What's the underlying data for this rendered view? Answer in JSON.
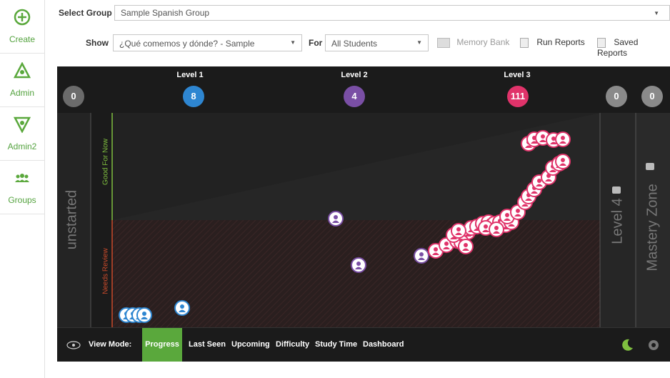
{
  "sidebar": {
    "items": [
      {
        "label": "Create",
        "icon": "plus-circle-icon"
      },
      {
        "label": "Admin",
        "icon": "admin-icon"
      },
      {
        "label": "Admin2",
        "icon": "admin2-icon"
      },
      {
        "label": "Groups",
        "icon": "groups-icon"
      }
    ],
    "accent": "#5aa83c"
  },
  "header": {
    "select_group_label": "Select Group",
    "select_group_value": "Sample Spanish Group",
    "show_label": "Show",
    "show_value": "¿Qué comemos y dónde? - Sample",
    "for_label": "For",
    "for_value": "All Students",
    "memory_bank": "Memory Bank",
    "run_reports": "Run Reports",
    "saved_reports": "Saved Reports"
  },
  "chart": {
    "levels": [
      {
        "title": "",
        "count": "0",
        "color": "#6b6b6b"
      },
      {
        "title": "Level 1",
        "count": "8",
        "color": "#2e86d1"
      },
      {
        "title": "Level 2",
        "count": "4",
        "color": "#7a4fa5"
      },
      {
        "title": "Level 3",
        "count": "111",
        "color": "#e0336a"
      },
      {
        "title": "",
        "count": "0",
        "color": "#8a8a8a"
      },
      {
        "title": "",
        "count": "0",
        "color": "#8a8a8a"
      }
    ],
    "zones": {
      "unstarted": "unstarted",
      "good_for_now": "Good For Now",
      "needs_review": "Needs Review",
      "level4": "Level 4",
      "mastery": "Mastery Zone"
    }
  },
  "view_mode": {
    "label": "View Mode:",
    "tabs": [
      "Progress",
      "Last Seen",
      "Upcoming",
      "Difficulty",
      "Study Time",
      "Dashboard"
    ],
    "active": "Progress",
    "active_color": "#5aa83c"
  }
}
